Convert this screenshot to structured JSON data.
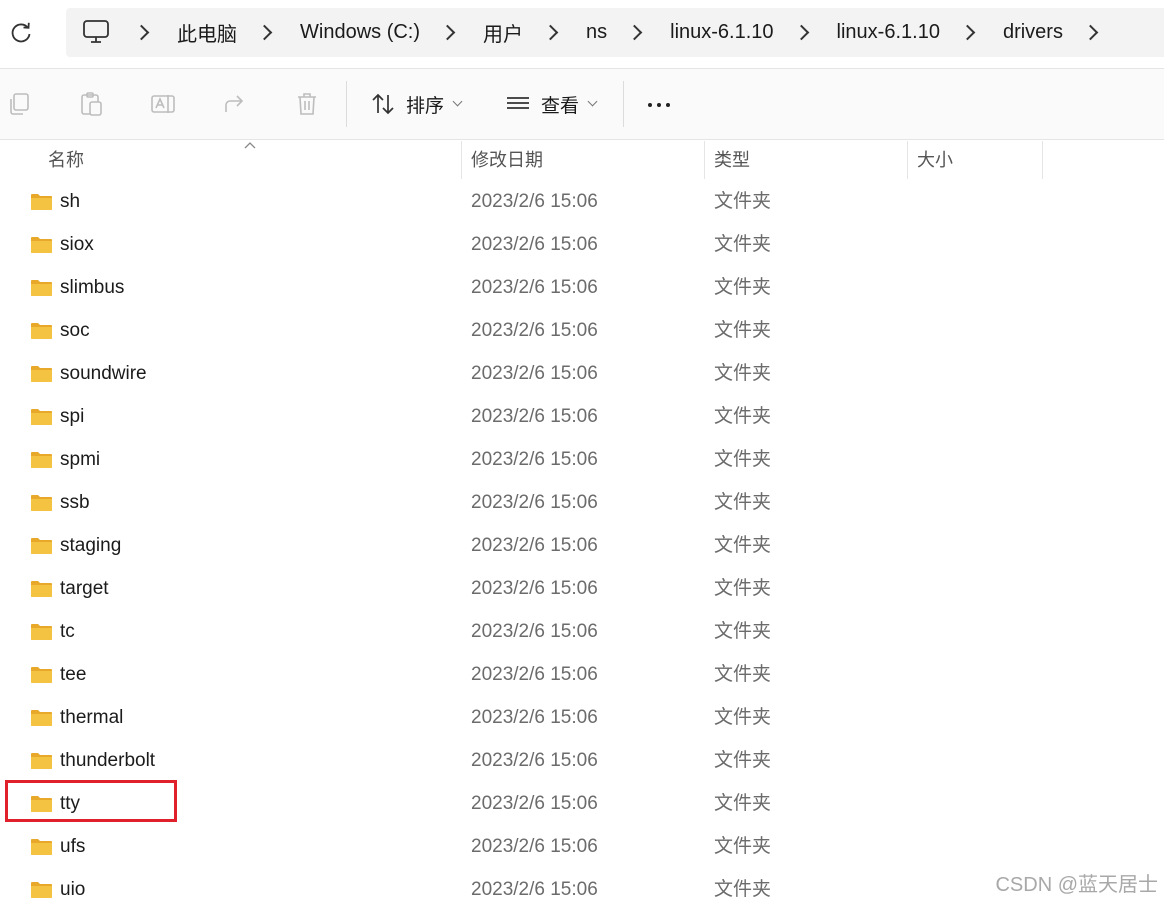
{
  "address_bar": {
    "breadcrumbs": [
      "此电脑",
      "Windows (C:)",
      "用户",
      "ns",
      "linux-6.1.10",
      "linux-6.1.10",
      "drivers"
    ]
  },
  "toolbar": {
    "sort_label": "排序",
    "view_label": "查看"
  },
  "columns": {
    "name": "名称",
    "date": "修改日期",
    "type": "类型",
    "size": "大小"
  },
  "files": [
    {
      "name": "sh",
      "date": "2023/2/6 15:06",
      "type": "文件夹"
    },
    {
      "name": "siox",
      "date": "2023/2/6 15:06",
      "type": "文件夹"
    },
    {
      "name": "slimbus",
      "date": "2023/2/6 15:06",
      "type": "文件夹"
    },
    {
      "name": "soc",
      "date": "2023/2/6 15:06",
      "type": "文件夹"
    },
    {
      "name": "soundwire",
      "date": "2023/2/6 15:06",
      "type": "文件夹"
    },
    {
      "name": "spi",
      "date": "2023/2/6 15:06",
      "type": "文件夹"
    },
    {
      "name": "spmi",
      "date": "2023/2/6 15:06",
      "type": "文件夹"
    },
    {
      "name": "ssb",
      "date": "2023/2/6 15:06",
      "type": "文件夹"
    },
    {
      "name": "staging",
      "date": "2023/2/6 15:06",
      "type": "文件夹"
    },
    {
      "name": "target",
      "date": "2023/2/6 15:06",
      "type": "文件夹"
    },
    {
      "name": "tc",
      "date": "2023/2/6 15:06",
      "type": "文件夹"
    },
    {
      "name": "tee",
      "date": "2023/2/6 15:06",
      "type": "文件夹"
    },
    {
      "name": "thermal",
      "date": "2023/2/6 15:06",
      "type": "文件夹"
    },
    {
      "name": "thunderbolt",
      "date": "2023/2/6 15:06",
      "type": "文件夹"
    },
    {
      "name": "tty",
      "date": "2023/2/6 15:06",
      "type": "文件夹"
    },
    {
      "name": "ufs",
      "date": "2023/2/6 15:06",
      "type": "文件夹"
    },
    {
      "name": "uio",
      "date": "2023/2/6 15:06",
      "type": "文件夹"
    }
  ],
  "watermark": "CSDN @蓝天居士",
  "colors": {
    "folder_yellow": "#f5c342",
    "highlight_red": "#e0202a",
    "breadcrumb_bg": "#f3f3f3"
  }
}
